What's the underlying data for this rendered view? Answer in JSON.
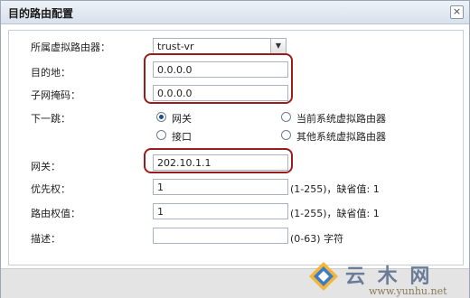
{
  "dialog": {
    "title": "目的路由配置",
    "close_glyph": "×"
  },
  "form": {
    "vr_label": "所属虚拟路由器：",
    "vr_value": "trust-vr",
    "dest_label": "目的地：",
    "dest_value": "0.0.0.0",
    "mask_label": "子网掩码：",
    "mask_value": "0.0.0.0",
    "nexthop_label": "下一跳：",
    "nexthop_options": [
      "网关",
      "当前系统虚拟路由器",
      "接口",
      "其他系统虚拟路由器"
    ],
    "gateway_label": "网关：",
    "gateway_value": "202.10.1.1",
    "priority_label": "优先权：",
    "priority_value": "1",
    "priority_hint": "(1-255)，缺省值: 1",
    "weight_label": "路由权值：",
    "weight_value": "1",
    "weight_hint": "(1-255)，缺省值: 1",
    "desc_label": "描述：",
    "desc_value": "",
    "desc_hint": "(0-63) 字符"
  },
  "watermark": {
    "brand": "云 木 网",
    "url": "www.yunhu.net"
  },
  "colors": {
    "highlight": "#9b1c1c",
    "radio_dot": "#1c4f8c"
  }
}
